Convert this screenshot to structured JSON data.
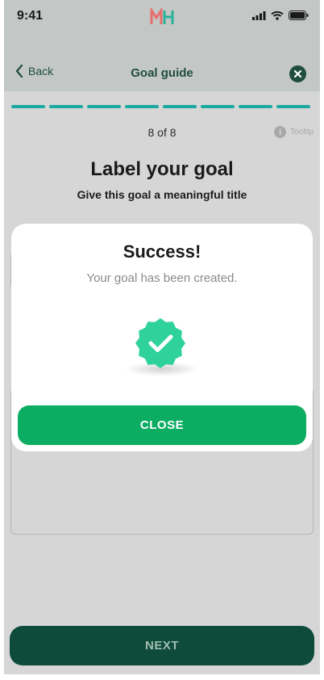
{
  "status_bar": {
    "time": "9:41",
    "logo_text": "MH"
  },
  "header": {
    "back_label": "Back",
    "title": "Goal guide"
  },
  "progress": {
    "total_steps": 8,
    "completed_steps": 8,
    "color": "#1aa9a0"
  },
  "step_indicator": {
    "text": "8 of 8"
  },
  "tooltip": {
    "label": "Tooltip",
    "icon": "info-icon"
  },
  "page": {
    "heading": "Label your goal",
    "subheading": "Give this goal a meaningful title"
  },
  "footer": {
    "next_label": "NEXT"
  },
  "modal": {
    "title": "Success!",
    "message": "Your goal has been created.",
    "icon": "check-badge-icon",
    "close_label": "CLOSE",
    "accent": "#0cad62",
    "badge_color": "#2fd29a"
  }
}
